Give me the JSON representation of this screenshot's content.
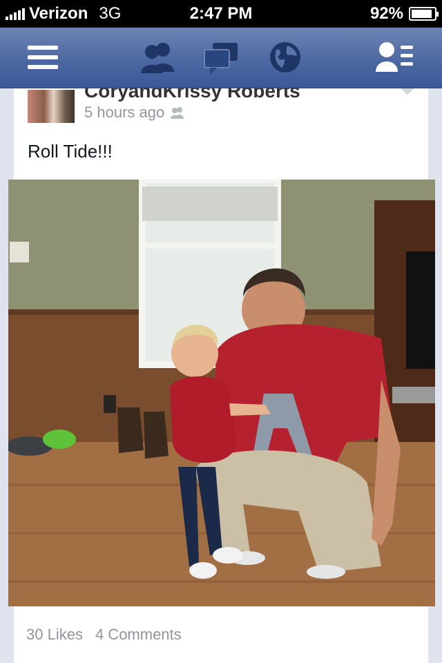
{
  "status_bar": {
    "carrier": "Verizon",
    "network": "3G",
    "time": "2:47 PM",
    "battery_percent": "92%",
    "battery_level": 0.92
  },
  "nav_bar": {
    "icons": [
      "menu-icon",
      "friend-requests-icon",
      "messages-icon",
      "notifications-globe-icon",
      "online-friends-icon"
    ]
  },
  "post": {
    "author": "CoryandKrissy Roberts",
    "timestamp": "5 hours ago",
    "privacy_icon": "friends-icon",
    "text": "Roll Tide!!!",
    "photo_description_icon": "photo",
    "likes": "30 Likes",
    "comments": "4 Comments"
  },
  "colors": {
    "nav_blue": "#3b5998",
    "secondary_text": "#90949c"
  }
}
